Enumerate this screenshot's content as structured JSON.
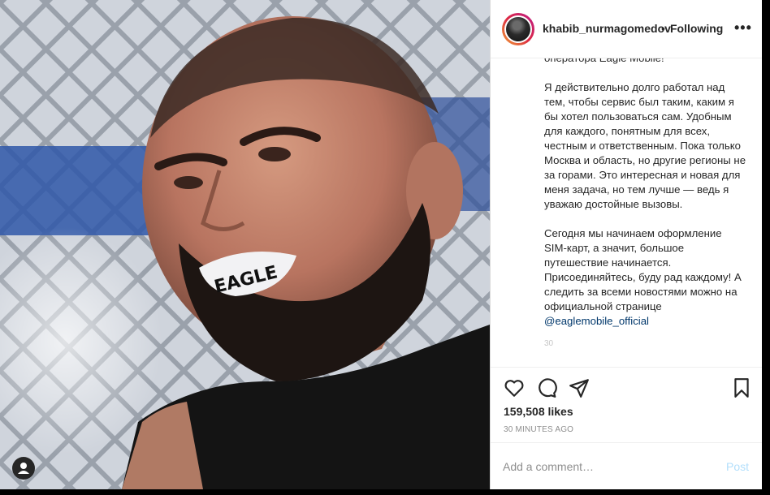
{
  "post": {
    "username": "khabib_nurmagomedov",
    "separator": "•",
    "following_label": "Following",
    "more_icon": "more-horizontal-icon",
    "mouthguard_text": "EAGLE"
  },
  "caption": {
    "paragraph_1": "оператора Eagle Mobile!",
    "paragraph_2": "Я действительно долго работал над тем, чтобы сервис был таким, каким я бы хотел пользоваться сам. Удобным для каждого, понятным для всех, честным и ответственным. Пока только Москва и область, но другие регионы не за горами. Это интересная и новая для меня задача, но тем лучше — ведь я уважаю достойные вызовы.",
    "paragraph_3": "Сегодня мы начинаем оформление SIM-карт, а значит, большое путешествие начинается. Присоединяйтесь, буду рад каждому! А следить за всеми новостями можно на официальной странице",
    "mention": "@eaglemobile_official",
    "truncated": "30"
  },
  "actions": {
    "like_icon": "heart-icon",
    "comment_icon": "comment-icon",
    "share_icon": "paper-plane-icon",
    "save_icon": "bookmark-icon"
  },
  "stats": {
    "likes": "159,508 likes",
    "time": "30 MINUTES AGO"
  },
  "comment": {
    "placeholder": "Add a comment…",
    "post_label": "Post"
  },
  "colors": {
    "text": "#262626",
    "muted": "#8e8e8e",
    "link": "#00376b",
    "post_disabled": "#b2dffc"
  }
}
